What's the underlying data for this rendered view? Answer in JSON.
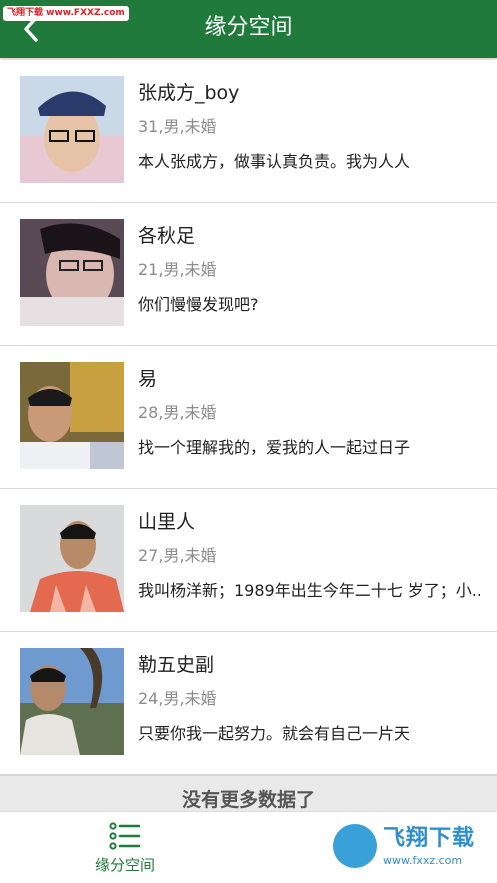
{
  "watermark": "飞翔下载 www.FXXZ.com",
  "header": {
    "title": "缘分空间",
    "color": "#1f7a3c"
  },
  "profiles": [
    {
      "name": "张成方_boy",
      "meta": "31,男,未婚",
      "bio": "本人张成方，做事认真负责。我为人人"
    },
    {
      "name": "各秋足",
      "meta": "21,男,未婚",
      "bio": "你们慢慢发现吧?"
    },
    {
      "name": "易",
      "meta": "28,男,未婚",
      "bio": "找一个理解我的，爱我的人一起过日子"
    },
    {
      "name": "山里人",
      "meta": "27,男,未婚",
      "bio": "我叫杨洋新；1989年出生今年二十七 岁了；小.."
    },
    {
      "name": "勒五史副",
      "meta": "24,男,未婚",
      "bio": "只要你我一起努力。就会有自己一片天"
    }
  ],
  "footer_message": "没有更多数据了",
  "tabbar": {
    "tabs": [
      {
        "label": "缘分空间",
        "icon": "list-icon",
        "active": true
      }
    ]
  },
  "brand": {
    "text": "飞翔下载",
    "sub": "www.fxxz.com"
  }
}
